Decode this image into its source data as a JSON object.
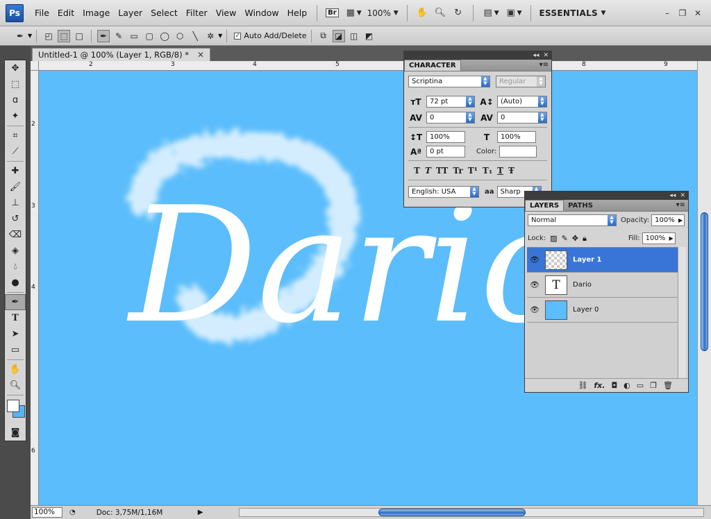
{
  "app": {
    "logo": "Ps",
    "workspace": "ESSENTIALS"
  },
  "menu": [
    "File",
    "Edit",
    "Image",
    "Layer",
    "Select",
    "Filter",
    "View",
    "Window",
    "Help"
  ],
  "appbar": {
    "bridge_label": "Br",
    "zoom": "100%"
  },
  "options": {
    "auto_add_delete_label": "Auto Add/Delete",
    "auto_add_delete_checked": "✓"
  },
  "document": {
    "tab_title": "Untitled-1 @ 100% (Layer 1, RGB/8) *",
    "canvas_color": "#5bbdfb",
    "text": "Dario"
  },
  "rulers": {
    "top": [
      "2",
      "3",
      "4",
      "5",
      "8",
      "9"
    ],
    "left": [
      "2",
      "3",
      "4",
      "6"
    ]
  },
  "status": {
    "zoom": "100%",
    "doc_info": "Doc: 3,75M/1,16M"
  },
  "character_panel": {
    "tab": "CHARACTER",
    "font_family": "Scriptina",
    "font_style": "Regular",
    "font_size": "72 pt",
    "leading": "(Auto)",
    "kerning": "0",
    "tracking": "0",
    "vertical_scale": "100%",
    "horizontal_scale": "100%",
    "baseline_shift": "0 pt",
    "color_label": "Color:",
    "language": "English: USA",
    "antialias_label": "aa",
    "antialias": "Sharp",
    "style_buttons": [
      "T",
      "T",
      "TT",
      "Tr",
      "T¹",
      "T₁",
      "T",
      "Ŧ"
    ]
  },
  "layers_panel": {
    "tabs": [
      "LAYERS",
      "PATHS"
    ],
    "blend_mode": "Normal",
    "opacity_label": "Opacity:",
    "opacity": "100%",
    "lock_label": "Lock:",
    "fill_label": "Fill:",
    "fill": "100%",
    "layers": [
      {
        "name": "Layer 1",
        "thumb_text": ""
      },
      {
        "name": "Dario",
        "thumb_text": "T"
      },
      {
        "name": "Layer 0",
        "thumb_text": ""
      }
    ]
  },
  "colors": {
    "foreground": "#ffffff",
    "background": "#5ab4f5",
    "selection": "#3875d7"
  }
}
